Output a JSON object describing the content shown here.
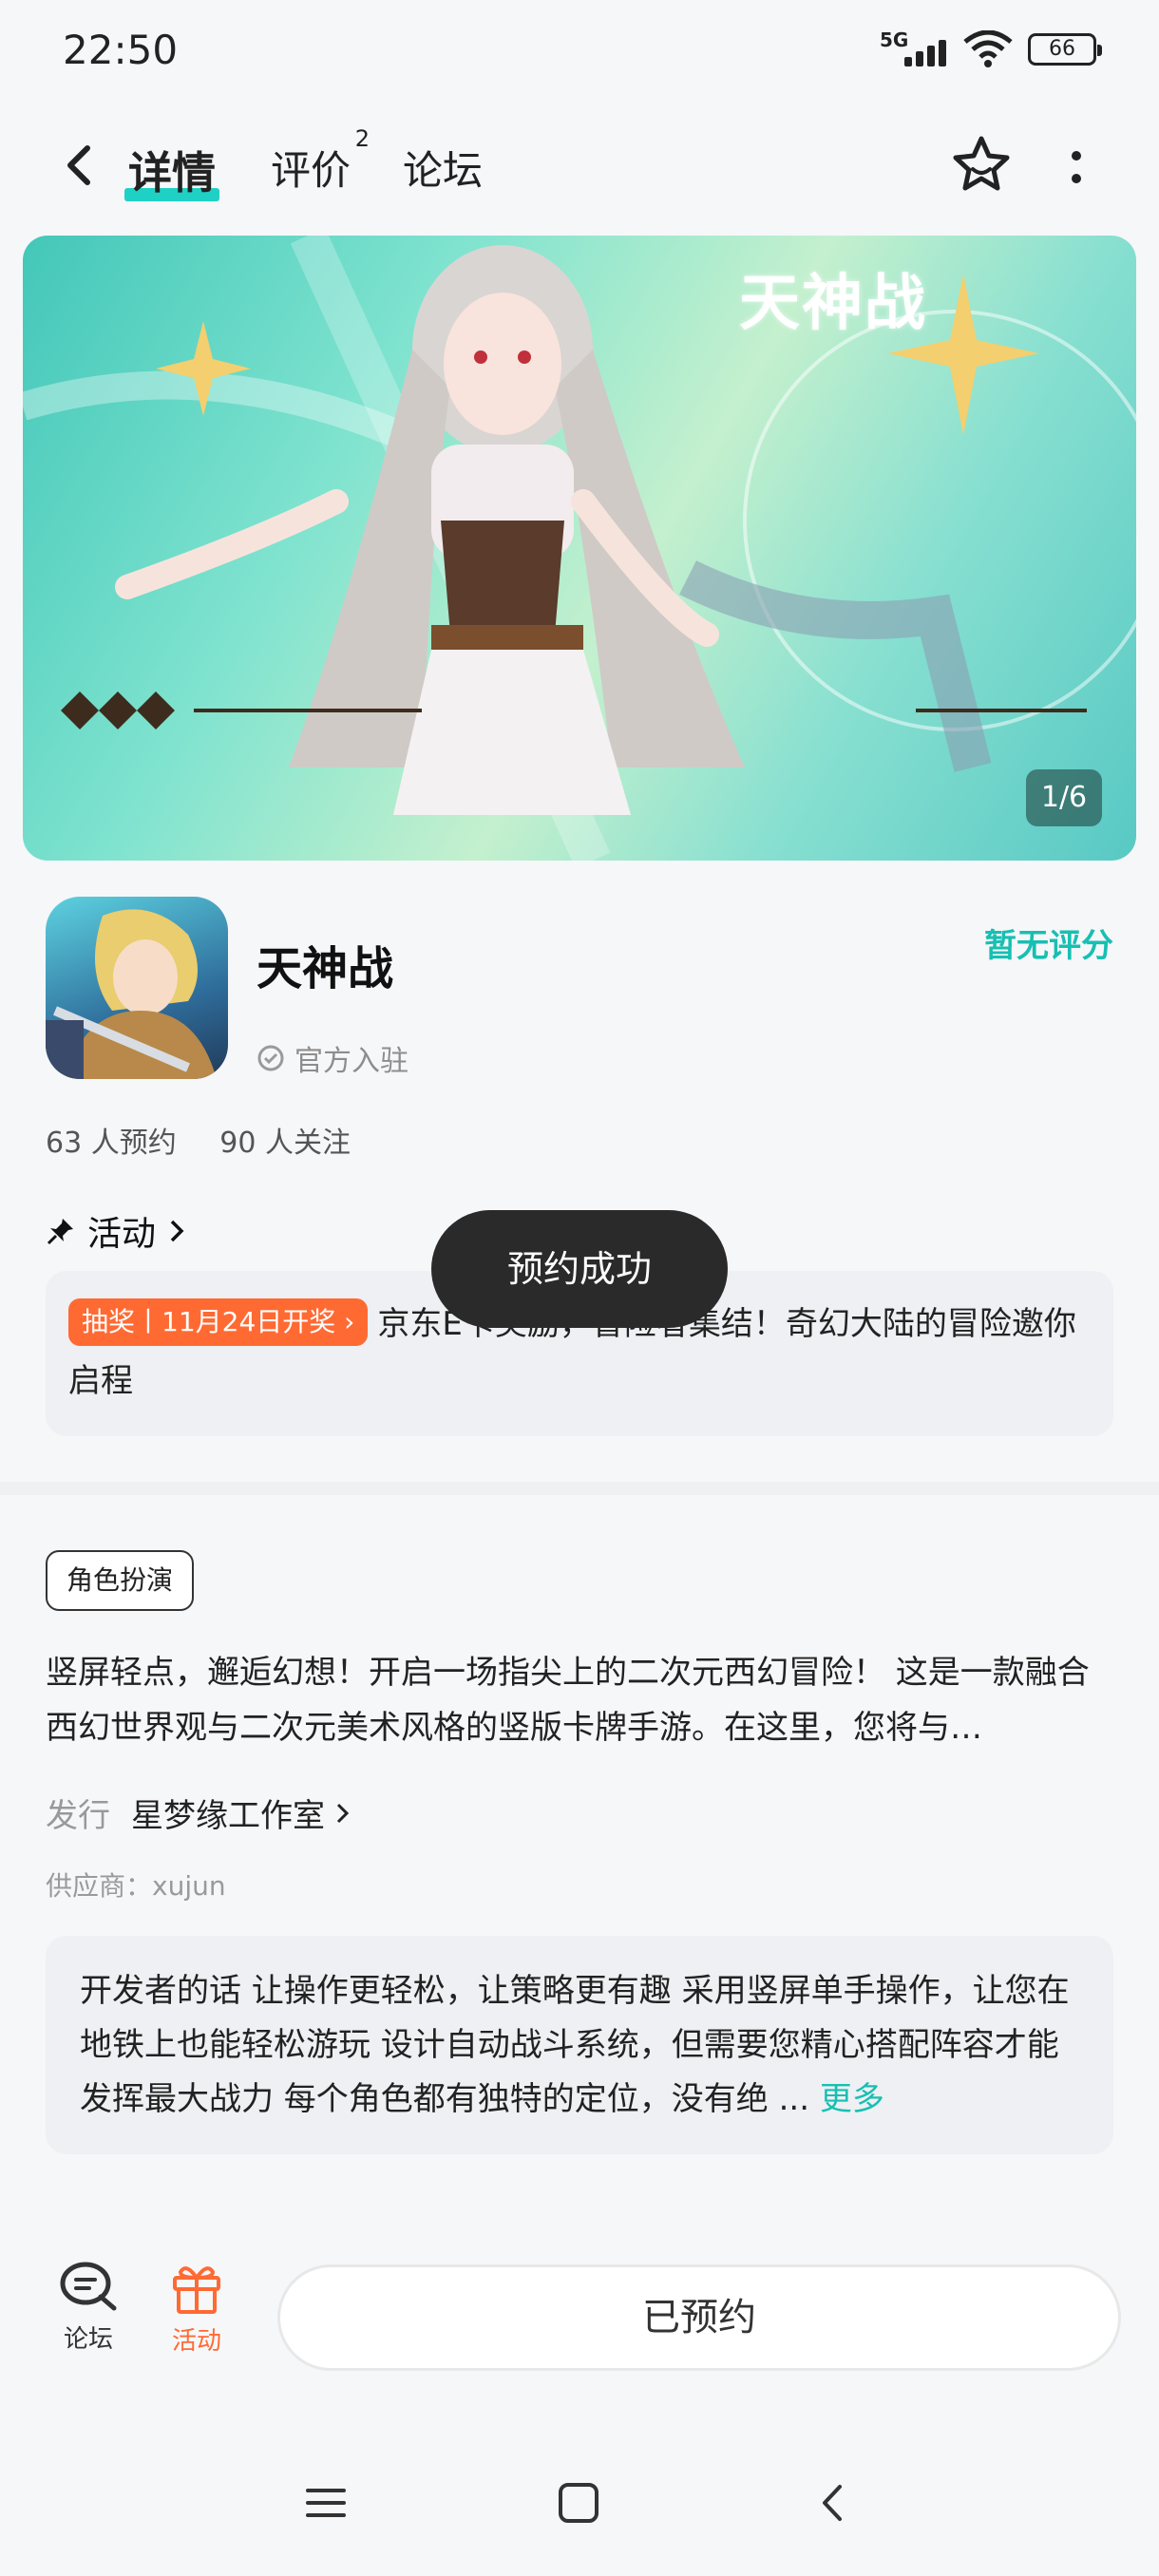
{
  "status_bar": {
    "time": "22:50",
    "network": "5G",
    "battery": "66"
  },
  "nav": {
    "tabs": [
      {
        "label": "详情"
      },
      {
        "label": "评价",
        "badge": "2"
      },
      {
        "label": "论坛"
      }
    ]
  },
  "banner": {
    "title_art": "天神战",
    "pager": "1/6"
  },
  "app": {
    "name": "天神战",
    "official": "官方入驻",
    "rating": "暂无评分",
    "reservations": "63 人预约",
    "follows": "90 人关注"
  },
  "activity": {
    "heading": "活动",
    "badge": "抽奖丨11月24日开奖 ›",
    "text": "京东E卡奖励，冒险者集结！奇幻大陆的冒险邀你启程"
  },
  "toast": "预约成功",
  "details": {
    "tag": "角色扮演",
    "description": "竖屏轻点，邂逅幻想！开启一场指尖上的二次元西幻冒险！ 这是一款融合西幻世界观与二次元美术风格的竖版卡牌手游。在这里，您将与…",
    "publisher_label": "发行",
    "publisher": "星梦缘工作室",
    "supplier": "供应商：xujun",
    "dev_words": "开发者的话  让操作更轻松，让策略更有趣 采用竖屏单手操作，让您在地铁上也能轻松游玩 设计自动战斗系统，但需要您精心搭配阵容才能发挥最大战力 每个角色都有独特的定位，没有绝 ...",
    "more": "更多"
  },
  "bottom_bar": {
    "forum": "论坛",
    "activity": "活动",
    "reserved": "已预约"
  },
  "colors": {
    "accent": "#18bfb2",
    "orange": "#ff6a33"
  }
}
